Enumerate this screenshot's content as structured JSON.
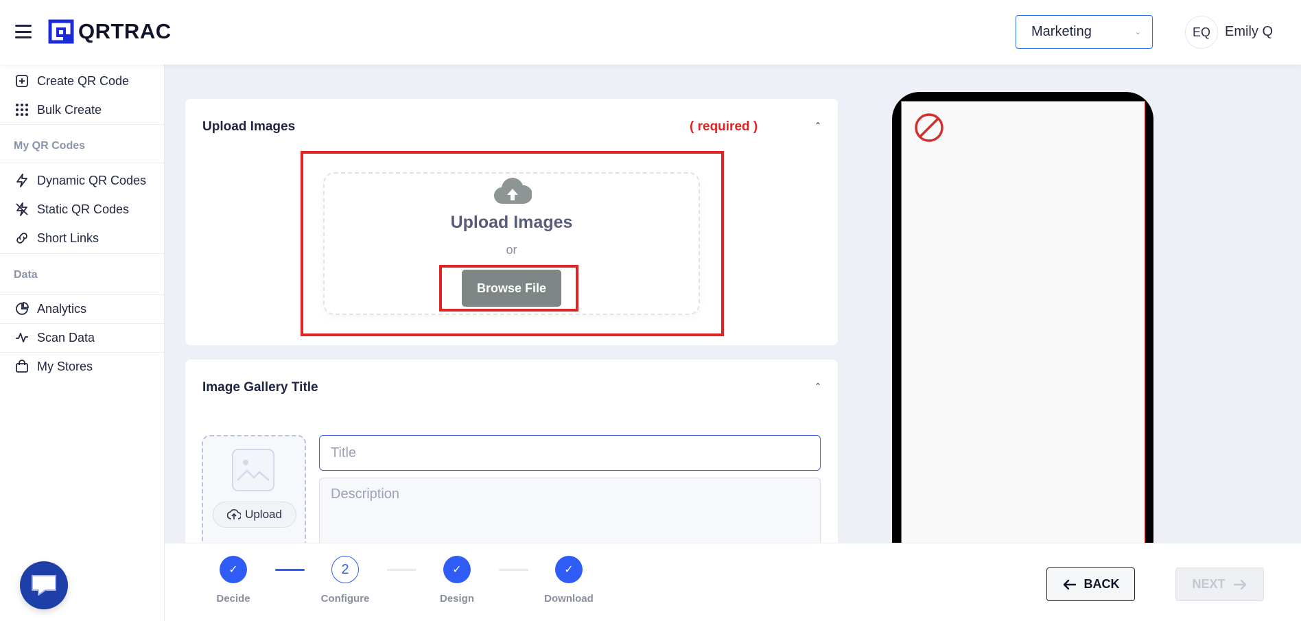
{
  "header": {
    "logo_text": "QRTRAC",
    "workspace_selected": "Marketing",
    "avatar_initials": "EQ",
    "user_name": "Emily Q"
  },
  "sidebar": {
    "items_top": [
      {
        "label": "Create QR Code",
        "icon": "plus-square-icon"
      },
      {
        "label": "Bulk Create",
        "icon": "grid-dots-icon"
      }
    ],
    "section_my_qr": "My QR Codes",
    "items_qr": [
      {
        "label": "Dynamic QR Codes",
        "icon": "lightning-icon"
      },
      {
        "label": "Static QR Codes",
        "icon": "lightning-off-icon"
      },
      {
        "label": "Short Links",
        "icon": "link-icon"
      }
    ],
    "section_data": "Data",
    "items_data": [
      {
        "label": "Analytics",
        "icon": "pie-chart-icon"
      },
      {
        "label": "Scan Data",
        "icon": "activity-icon"
      },
      {
        "label": "My Stores",
        "icon": "shopping-bag-icon"
      }
    ]
  },
  "upload_card": {
    "title": "Upload Images",
    "required_label": "( required )",
    "dropzone_title": "Upload Images",
    "or_text": "or",
    "browse_label": "Browse File"
  },
  "gallery_card": {
    "title": "Image Gallery Title",
    "upload_label": "Upload",
    "title_placeholder": "Title",
    "description_placeholder": "Description"
  },
  "stepper": {
    "steps": [
      {
        "label": "Decide",
        "state": "done"
      },
      {
        "label": "Configure",
        "state": "current",
        "number": "2"
      },
      {
        "label": "Design",
        "state": "done"
      },
      {
        "label": "Download",
        "state": "done"
      }
    ]
  },
  "footer": {
    "back_label": "BACK",
    "next_label": "NEXT"
  },
  "colors": {
    "accent": "#2f5cf5",
    "required": "#e02424",
    "browse_button": "#7d8585",
    "background": "#edf0f7"
  }
}
